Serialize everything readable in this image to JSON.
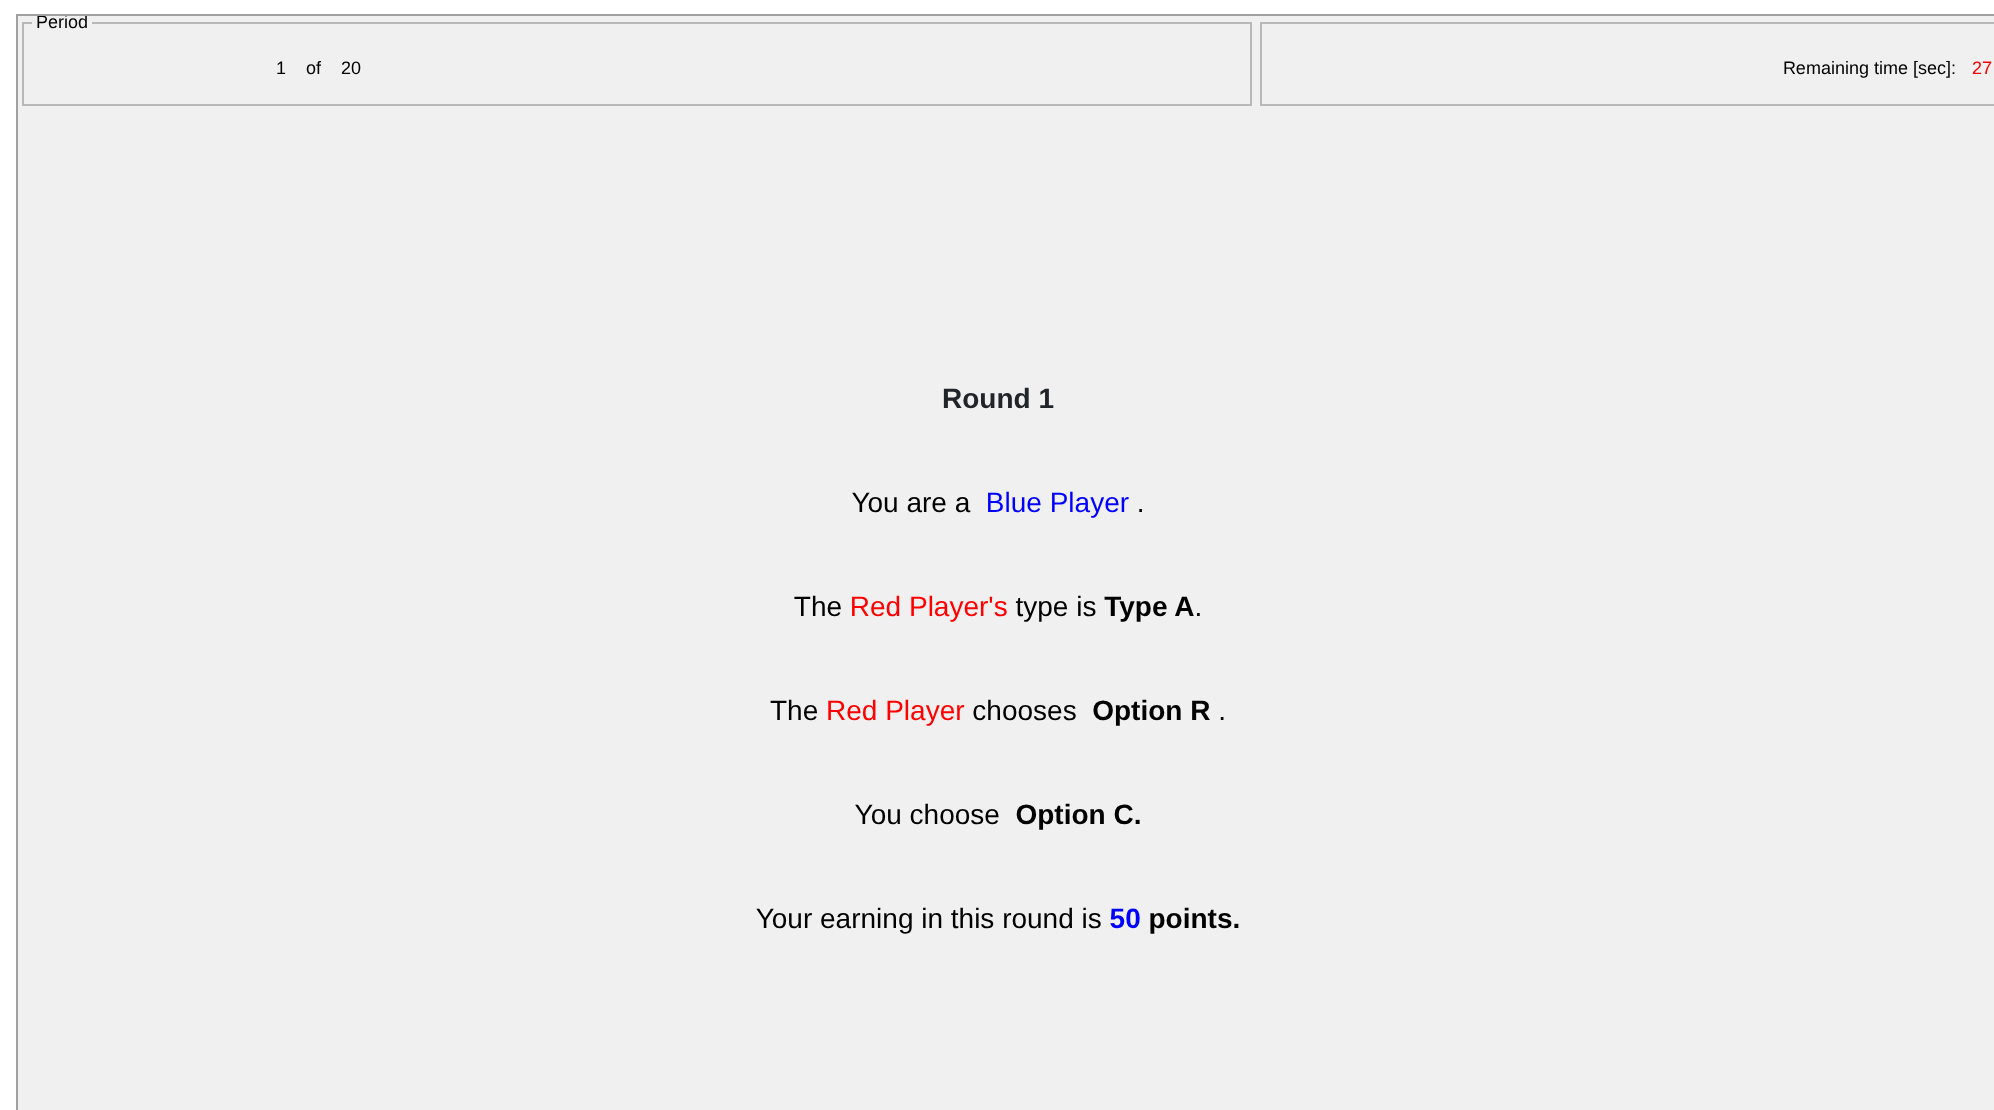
{
  "period": {
    "legend": "Period",
    "current": "1",
    "of": "of",
    "total": "20"
  },
  "timer": {
    "label": "Remaining time [sec]:",
    "value": "27"
  },
  "title": "Round 1",
  "lines": [
    [
      {
        "text": "You are a  ",
        "color": "#000000"
      },
      {
        "text": "Blue Player",
        "color": "#0000ff"
      },
      {
        "text": " .",
        "color": "#000000"
      }
    ],
    [
      {
        "text": "The ",
        "color": "#000000"
      },
      {
        "text": "Red Player's",
        "color": "#ff0000"
      },
      {
        "text": " type is **Type A**.",
        "color": "#000000"
      }
    ],
    [
      {
        "text": "The ",
        "color": "#000000"
      },
      {
        "text": "Red Player",
        "color": "#ff0000"
      },
      {
        "text": " chooses  **Option R** .",
        "color": "#000000"
      }
    ],
    [
      {
        "text": "You choose  **Option C.**",
        "color": "#000000"
      }
    ],
    [
      {
        "text": "Your earning in this round is ",
        "color": "#000000"
      },
      {
        "text": "**50**",
        "color": "#0000ff"
      },
      {
        "text": " **points.**",
        "color": "#000000"
      }
    ]
  ]
}
